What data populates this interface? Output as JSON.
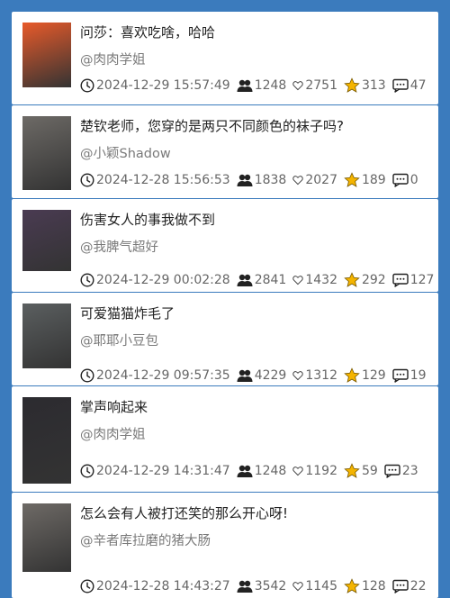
{
  "posts": [
    {
      "title": "问莎：喜欢吃啥，哈哈",
      "author": "@肉肉学姐",
      "time": "2024-12-29 15:57:49",
      "views": "1248",
      "likes": "2751",
      "stars": "313",
      "comments": "47",
      "thumb_bg": "#e85a2a"
    },
    {
      "title": "楚钦老师，您穿的是两只不同颜色的袜子吗?",
      "author": "@小颖Shadow",
      "time": "2024-12-28 15:56:53",
      "views": "1838",
      "likes": "2027",
      "stars": "189",
      "comments": "0",
      "thumb_bg": "#6d6a66"
    },
    {
      "title": "伤害女人的事我做不到",
      "author": "@我脾气超好",
      "time": "2024-12-29 00:02:28",
      "views": "2841",
      "likes": "1432",
      "stars": "292",
      "comments": "127",
      "thumb_bg": "#4a3b52"
    },
    {
      "title": "可爱猫猫炸毛了",
      "author": "@耶耶小豆包",
      "time": "2024-12-29 09:57:35",
      "views": "4229",
      "likes": "1312",
      "stars": "129",
      "comments": "19",
      "thumb_bg": "#5b5f60"
    },
    {
      "title": "掌声响起来",
      "author": "@肉肉学姐",
      "time": "2024-12-29 14:31:47",
      "views": "1248",
      "likes": "1192",
      "stars": "59",
      "comments": "23",
      "thumb_bg": "#2c2b30"
    },
    {
      "title": "怎么会有人被打还笑的那么开心呀!",
      "author": "@辛者库拉磨的猪大肠",
      "time": "2024-12-28 14:43:27",
      "views": "3542",
      "likes": "1145",
      "stars": "128",
      "comments": "22",
      "thumb_bg": "#6e6a66"
    }
  ],
  "colors": {
    "background": "#3b7bbd",
    "star": "#f4b400"
  },
  "icons": {
    "time": "clock-icon",
    "views": "people-icon",
    "likes": "heart-icon",
    "stars": "star-icon",
    "comments": "comment-icon"
  }
}
